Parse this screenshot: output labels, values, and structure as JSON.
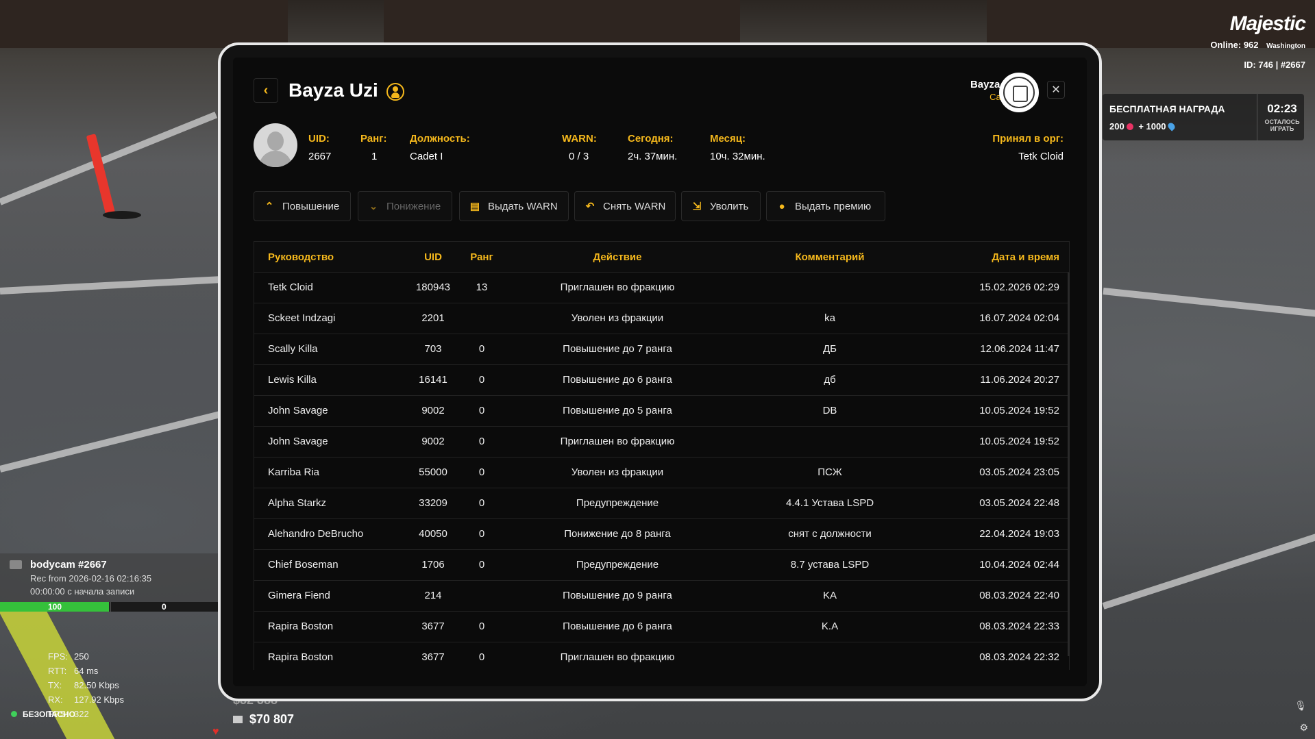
{
  "hud": {
    "logo": "Majestic",
    "online_label": "Online:",
    "online_count": "962",
    "server": "Washington",
    "id_line": "ID: 746 | #2667",
    "reward_title": "БЕСПЛАТНАЯ НАГРАДА",
    "reward_coins": "200",
    "reward_plus": "+",
    "reward_points": "1000",
    "reward_time": "02:23",
    "reward_left": "ОСТАЛОСЬ ИГРАТЬ",
    "bodycam_title": "bodycam #2667",
    "bodycam_rec": "Rec from 2026-02-16 02:16:35",
    "bodycam_elapsed": "00:00:00 с начала записи",
    "health": "100",
    "health_fraction": 0.5,
    "armor": "0",
    "net": [
      {
        "label": "FPS:",
        "value": "250"
      },
      {
        "label": "RTT:",
        "value": "64 ms"
      },
      {
        "label": "TX:",
        "value": "82.50 Kbps"
      },
      {
        "label": "RX:",
        "value": "127.92 Kbps"
      },
      {
        "label": "PPS:",
        "value": "322"
      }
    ],
    "safe_zone": "БЕЗОПАСНО",
    "money_old": "$32 388",
    "money": "$70 807"
  },
  "profile": {
    "name": "Bayza Uzi",
    "header_name": "Bayza Uzi",
    "header_rank": "Cadet I",
    "uid_label": "UID:",
    "uid": "2667",
    "rank_label": "Ранг:",
    "rank": "1",
    "position_label": "Должность:",
    "position": "Cadet I",
    "warn_label": "WARN:",
    "warn": "0 / 3",
    "today_label": "Сегодня:",
    "today": "2ч. 37мин.",
    "month_label": "Месяц:",
    "month": "10ч. 32мин.",
    "accepted_label": "Принял в орг:",
    "accepted_by": "Tetk Cloid"
  },
  "actions": {
    "promote": "Повышение",
    "demote": "Понижение",
    "give_warn": "Выдать WARN",
    "remove_warn": "Снять WARN",
    "fire": "Уволить",
    "bonus": "Выдать премию"
  },
  "table": {
    "headers": {
      "leader": "Руководство",
      "uid": "UID",
      "rank": "Ранг",
      "action": "Действие",
      "comment": "Комментарий",
      "datetime": "Дата и время"
    },
    "rows": [
      {
        "leader": "Tetk Cloid",
        "uid": "180943",
        "rank": "13",
        "action": "Приглашен во фракцию",
        "comment": "",
        "datetime": "15.02.2026 02:29"
      },
      {
        "leader": "Sckeet Indzagi",
        "uid": "2201",
        "rank": "",
        "action": "Уволен из фракции",
        "comment": "ka",
        "datetime": "16.07.2024 02:04"
      },
      {
        "leader": "Scally Killa",
        "uid": "703",
        "rank": "0",
        "action": "Повышение до 7 ранга",
        "comment": "ДБ",
        "datetime": "12.06.2024 11:47"
      },
      {
        "leader": "Lewis Killa",
        "uid": "16141",
        "rank": "0",
        "action": "Повышение до 6 ранга",
        "comment": "дб",
        "datetime": "11.06.2024 20:27"
      },
      {
        "leader": "John Savage",
        "uid": "9002",
        "rank": "0",
        "action": "Повышение до 5 ранга",
        "comment": "DB",
        "datetime": "10.05.2024 19:52"
      },
      {
        "leader": "John Savage",
        "uid": "9002",
        "rank": "0",
        "action": "Приглашен во фракцию",
        "comment": "",
        "datetime": "10.05.2024 19:52"
      },
      {
        "leader": "Karriba Ria",
        "uid": "55000",
        "rank": "0",
        "action": "Уволен из фракции",
        "comment": "ПСЖ",
        "datetime": "03.05.2024 23:05"
      },
      {
        "leader": "Alpha Starkz",
        "uid": "33209",
        "rank": "0",
        "action": "Предупреждение",
        "comment": "4.4.1 Устава LSPD",
        "datetime": "03.05.2024 22:48"
      },
      {
        "leader": "Alehandro DeBrucho",
        "uid": "40050",
        "rank": "0",
        "action": "Понижение до 8 ранга",
        "comment": "снят с должности",
        "datetime": "22.04.2024 19:03"
      },
      {
        "leader": "Chief Boseman",
        "uid": "1706",
        "rank": "0",
        "action": "Предупреждение",
        "comment": "8.7 устава LSPD",
        "datetime": "10.04.2024 02:44"
      },
      {
        "leader": "Gimera Fiend",
        "uid": "214",
        "rank": "",
        "action": "Повышение до 9 ранга",
        "comment": "KA",
        "datetime": "08.03.2024 22:40"
      },
      {
        "leader": "Rapira Boston",
        "uid": "3677",
        "rank": "0",
        "action": "Повышение до 6 ранга",
        "comment": "K.A",
        "datetime": "08.03.2024 22:33"
      },
      {
        "leader": "Rapira Boston",
        "uid": "3677",
        "rank": "0",
        "action": "Приглашен во фракцию",
        "comment": "",
        "datetime": "08.03.2024 22:32"
      }
    ]
  },
  "colors": {
    "accent": "#f5b81c",
    "health": "#35c13b",
    "panel": "#0b0b0b"
  },
  "icons": {
    "back": "chevron-left-icon",
    "close": "close-icon",
    "profile_badge": "person-circle-icon",
    "promote": "chevron-up-icon",
    "demote": "chevron-down-icon",
    "give_warn": "document-warn-icon",
    "remove_warn": "undo-arrow-icon",
    "fire": "exit-person-icon",
    "bonus": "coin-icon"
  }
}
